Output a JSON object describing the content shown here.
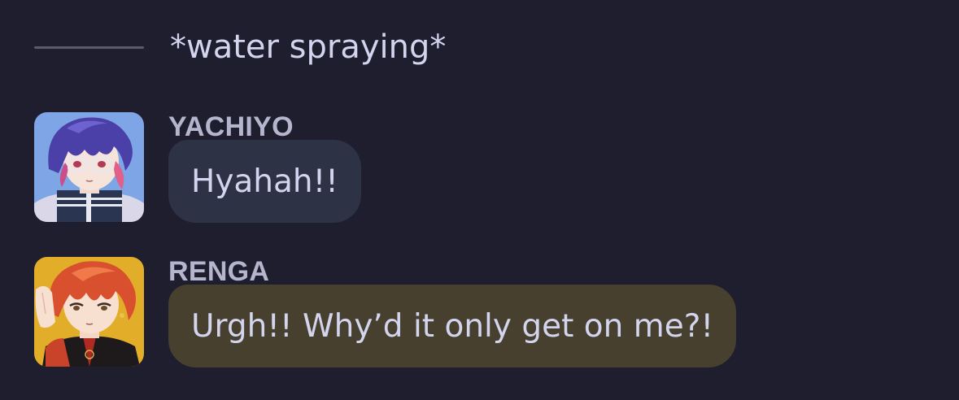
{
  "narration": {
    "text": "*water spraying*"
  },
  "messages": [
    {
      "speaker": "YACHIYO",
      "text": "Hyahah!!",
      "avatar_icon": "yachiyo-avatar",
      "bubble_color": "#2d3344"
    },
    {
      "speaker": "RENGA",
      "text": "Urgh!! Why’d it only get on me?!",
      "avatar_icon": "renga-avatar",
      "bubble_color": "#47402e"
    }
  ],
  "colors": {
    "background": "#1f1e2e",
    "text": "#d3d4ee",
    "speaker_name": "#b5b6cd",
    "divider": "#5a5a6c"
  }
}
